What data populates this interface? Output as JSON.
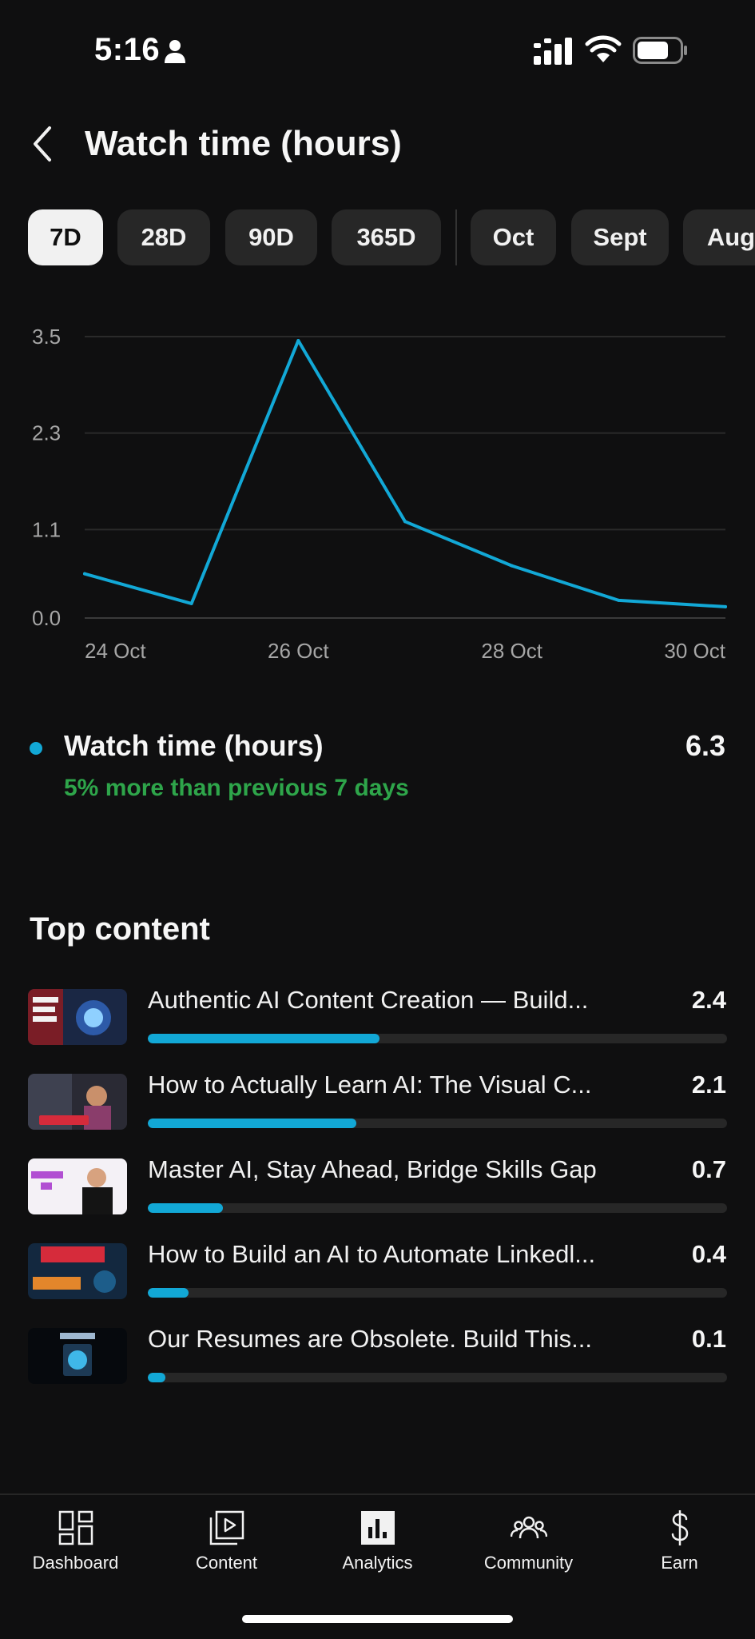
{
  "status_bar": {
    "time": "5:16"
  },
  "header": {
    "title": "Watch time (hours)"
  },
  "range_tabs": [
    {
      "label": "7D",
      "active": true
    },
    {
      "label": "28D",
      "active": false
    },
    {
      "label": "90D",
      "active": false
    },
    {
      "label": "365D",
      "active": false
    },
    {
      "label": "Oct",
      "active": false
    },
    {
      "label": "Sept",
      "active": false
    },
    {
      "label": "Aug",
      "active": false
    }
  ],
  "chart_data": {
    "type": "line",
    "x": [
      "24 Oct",
      "25 Oct",
      "26 Oct",
      "27 Oct",
      "28 Oct",
      "29 Oct",
      "30 Oct"
    ],
    "x_tick_labels": [
      "24 Oct",
      "26 Oct",
      "28 Oct",
      "30 Oct"
    ],
    "y_tick_labels": [
      "3.5",
      "2.3",
      "1.1",
      "0.0"
    ],
    "ylim": [
      0,
      3.5
    ],
    "grid": true,
    "series": [
      {
        "values": [
          0.55,
          0.18,
          3.45,
          1.2,
          0.65,
          0.22,
          0.14
        ],
        "color": "#12a8d6"
      }
    ]
  },
  "legend": {
    "label": "Watch time (hours)",
    "value": "6.3",
    "change_text": "5% more than previous 7 days",
    "dot_color": "#12a8d6",
    "change_color": "#2ea54a"
  },
  "top_content": {
    "title": "Top content",
    "items": [
      {
        "title": "Authentic AI Content Creation — Build...",
        "value": "2.4",
        "fraction": 0.4
      },
      {
        "title": "How to Actually Learn AI: The Visual C...",
        "value": "2.1",
        "fraction": 0.36
      },
      {
        "title": "Master AI, Stay Ahead, Bridge Skills Gap",
        "value": "0.7",
        "fraction": 0.13
      },
      {
        "title": "How to Build an AI to Automate Linkedl...",
        "value": "0.4",
        "fraction": 0.07
      },
      {
        "title": "Our Resumes are Obsolete. Build This...",
        "value": "0.1",
        "fraction": 0.03
      }
    ]
  },
  "bottom_nav": [
    {
      "label": "Dashboard",
      "icon": "dashboard-icon"
    },
    {
      "label": "Content",
      "icon": "content-icon"
    },
    {
      "label": "Analytics",
      "icon": "analytics-icon",
      "active": true
    },
    {
      "label": "Community",
      "icon": "community-icon"
    },
    {
      "label": "Earn",
      "icon": "earn-icon"
    }
  ]
}
